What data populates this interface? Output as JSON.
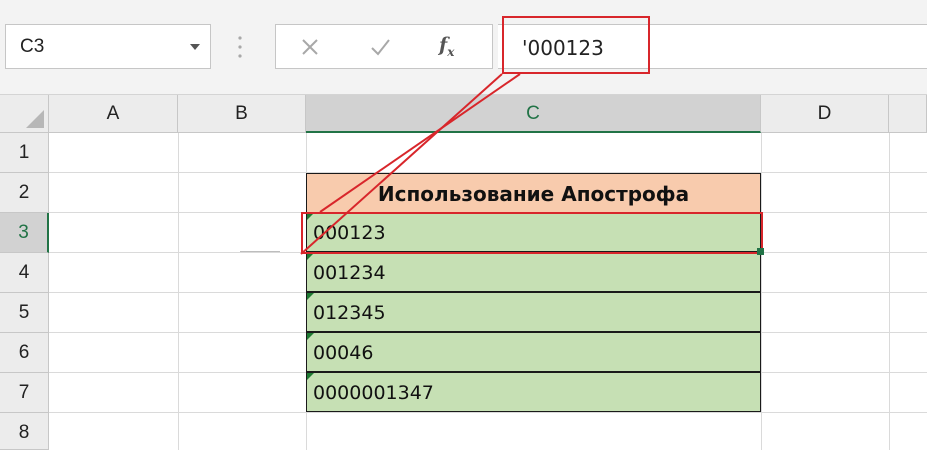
{
  "name_box": {
    "value": "C3"
  },
  "formula_bar": {
    "fx_label": "f",
    "fx_sub": "x",
    "value": "'000123"
  },
  "columns": [
    "A",
    "B",
    "C",
    "D"
  ],
  "rows": [
    "1",
    "2",
    "3",
    "4",
    "5",
    "6",
    "7",
    "8"
  ],
  "table": {
    "header": "Использование Апострофа",
    "values": [
      "000123",
      "001234",
      "012345",
      "00046",
      "0000001347"
    ]
  },
  "colors": {
    "header_fill": "#f8cbad",
    "data_fill": "#c6e0b4",
    "highlight": "#d8262b",
    "accent": "#217346"
  }
}
